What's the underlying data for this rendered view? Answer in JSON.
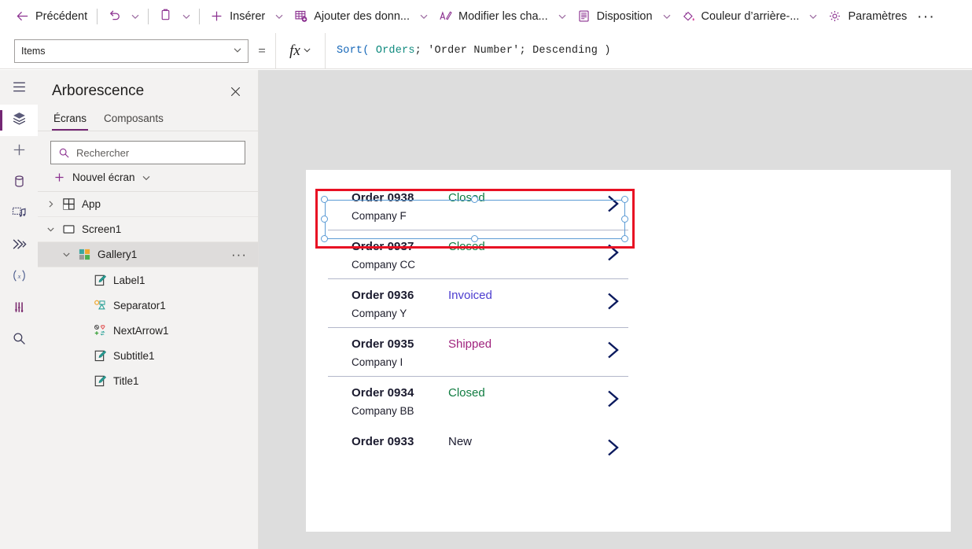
{
  "command_bar": {
    "back_label": "Précédent",
    "insert_label": "Insérer",
    "add_data_label": "Ajouter des donn...",
    "edit_fields_label": "Modifier les cha...",
    "layout_label": "Disposition",
    "background_color_label": "Couleur d’arrière-...",
    "settings_label": "Paramètres",
    "overflow_label": "···",
    "icons": {
      "back": "arrow-left-icon",
      "undo": "undo-icon",
      "paste": "clipboard-icon",
      "insert": "plus-icon",
      "add_data": "table-add-icon",
      "edit_fields": "edit-fields-icon",
      "layout": "layout-icon",
      "background_color": "paint-bucket-icon",
      "settings": "gear-icon"
    }
  },
  "formula_bar": {
    "property": "Items",
    "equals": "=",
    "fx_label": "fx",
    "formula_tokens": [
      {
        "text": "Sort(",
        "kind": "fn"
      },
      {
        "text": " ",
        "kind": "plain"
      },
      {
        "text": "Orders",
        "kind": "table"
      },
      {
        "text": "; 'Order Number'; Descending )",
        "kind": "plain"
      }
    ],
    "formula_plain": "Sort( Orders; 'Order Number'; Descending )"
  },
  "rail": {
    "items": [
      {
        "name": "hamburger-menu-icon",
        "active": false
      },
      {
        "name": "tree-view-icon",
        "active": true
      },
      {
        "name": "insert-plus-icon",
        "active": false
      },
      {
        "name": "data-cylinder-icon",
        "active": false
      },
      {
        "name": "media-icon",
        "active": false
      },
      {
        "name": "power-automate-icon",
        "active": false
      },
      {
        "name": "variables-icon",
        "active": false
      },
      {
        "name": "app-checker-icon",
        "active": false
      },
      {
        "name": "search-icon",
        "active": false
      }
    ]
  },
  "tree_panel": {
    "title": "Arborescence",
    "close_label": "✕",
    "tabs": [
      {
        "label": "Écrans",
        "active": true
      },
      {
        "label": "Composants",
        "active": false
      }
    ],
    "search_placeholder": "Rechercher",
    "search_value": "",
    "new_screen_label": "Nouvel écran",
    "items": [
      {
        "label": "App",
        "indent": 0,
        "icon": "app-icon",
        "expanded": false,
        "selected": false,
        "has_more": false
      },
      {
        "label": "Screen1",
        "indent": 0,
        "icon": "screen-icon",
        "expanded": true,
        "selected": false,
        "has_more": false
      },
      {
        "label": "Gallery1",
        "indent": 1,
        "icon": "gallery-icon",
        "expanded": true,
        "selected": true,
        "has_more": true
      },
      {
        "label": "Label1",
        "indent": 2,
        "icon": "label-icon",
        "expanded": null,
        "selected": false,
        "has_more": false
      },
      {
        "label": "Separator1",
        "indent": 2,
        "icon": "separator-icon",
        "expanded": null,
        "selected": false,
        "has_more": false
      },
      {
        "label": "NextArrow1",
        "indent": 2,
        "icon": "icon-shape-icon",
        "expanded": null,
        "selected": false,
        "has_more": false
      },
      {
        "label": "Subtitle1",
        "indent": 2,
        "icon": "label-icon",
        "expanded": null,
        "selected": false,
        "has_more": false
      },
      {
        "label": "Title1",
        "indent": 2,
        "icon": "label-icon",
        "expanded": null,
        "selected": false,
        "has_more": false
      }
    ]
  },
  "canvas": {
    "gallery": {
      "selected_index": 0,
      "rows": [
        {
          "title": "Order 0938",
          "subtitle": "Company F",
          "status": "Closed",
          "status_color": "#107c41",
          "separator": false
        },
        {
          "title": "Order 0937",
          "subtitle": "Company CC",
          "status": "Closed",
          "status_color": "#107c41",
          "separator": true
        },
        {
          "title": "Order 0936",
          "subtitle": "Company Y",
          "status": "Invoiced",
          "status_color": "#4b3ccf",
          "separator": true
        },
        {
          "title": "Order 0935",
          "subtitle": "Company I",
          "status": "Shipped",
          "status_color": "#a0247e",
          "separator": true
        },
        {
          "title": "Order 0934",
          "subtitle": "Company BB",
          "status": "Closed",
          "status_color": "#107c41",
          "separator": true
        },
        {
          "title": "Order 0933",
          "subtitle": "",
          "status": "New",
          "status_color": "#1a1a2e",
          "separator": false
        }
      ]
    },
    "colors": {
      "selection_outline": "#e81123",
      "selection_box": "#5b9bd5",
      "chevron": "#0b1a5e",
      "background": "#dddddd"
    }
  }
}
